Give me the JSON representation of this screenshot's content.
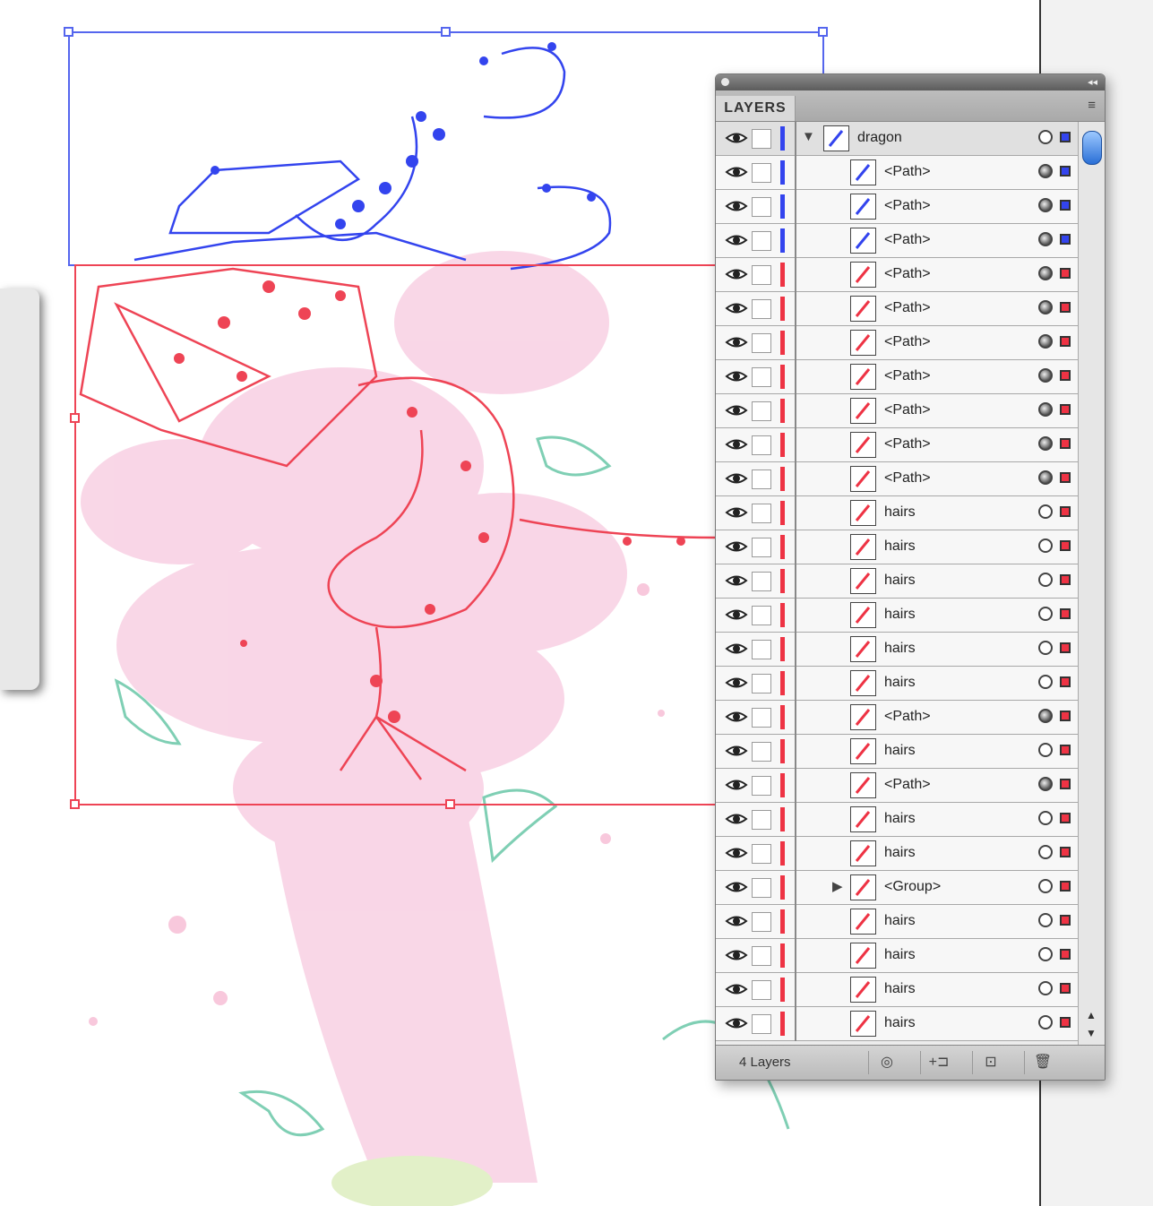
{
  "panel": {
    "tab_label": "LAYERS",
    "footer_count": "4 Layers",
    "colors": {
      "blue": "#3344ee",
      "red": "#ee3344",
      "pink": "#f5c4dc",
      "teal": "#9fd9c8"
    },
    "buttons": [
      {
        "name": "make-clipping-mask-button",
        "icon": "◎"
      },
      {
        "name": "create-sublayer-button",
        "icon": "+⊐"
      },
      {
        "name": "create-new-layer-button",
        "icon": "⊡"
      },
      {
        "name": "delete-layer-button",
        "icon": "🗑"
      }
    ],
    "menu_icon": "≡",
    "collapse_icon": "◂◂"
  },
  "layers": [
    {
      "name": "dragon",
      "type": "layer",
      "color": "#3344ee",
      "expanded": true,
      "target": "hollow"
    },
    {
      "name": "<Path>",
      "color": "#3344ee",
      "target": "filled"
    },
    {
      "name": "<Path>",
      "color": "#3344ee",
      "target": "filled"
    },
    {
      "name": "<Path>",
      "color": "#3344ee",
      "target": "filled"
    },
    {
      "name": "<Path>",
      "color": "#ee3344",
      "target": "filled"
    },
    {
      "name": "<Path>",
      "color": "#ee3344",
      "target": "filled"
    },
    {
      "name": "<Path>",
      "color": "#ee3344",
      "target": "filled"
    },
    {
      "name": "<Path>",
      "color": "#ee3344",
      "target": "filled"
    },
    {
      "name": "<Path>",
      "color": "#ee3344",
      "target": "filled"
    },
    {
      "name": "<Path>",
      "color": "#ee3344",
      "target": "filled"
    },
    {
      "name": "<Path>",
      "color": "#ee3344",
      "target": "filled"
    },
    {
      "name": "hairs",
      "color": "#ee3344",
      "target": "hollow"
    },
    {
      "name": "hairs",
      "color": "#ee3344",
      "target": "hollow"
    },
    {
      "name": "hairs",
      "color": "#ee3344",
      "target": "hollow"
    },
    {
      "name": "hairs",
      "color": "#ee3344",
      "target": "hollow"
    },
    {
      "name": "hairs",
      "color": "#ee3344",
      "target": "hollow"
    },
    {
      "name": "hairs",
      "color": "#ee3344",
      "target": "hollow"
    },
    {
      "name": "<Path>",
      "color": "#ee3344",
      "target": "filled"
    },
    {
      "name": "hairs",
      "color": "#ee3344",
      "target": "hollow"
    },
    {
      "name": "<Path>",
      "color": "#ee3344",
      "target": "filled"
    },
    {
      "name": "hairs",
      "color": "#ee3344",
      "target": "hollow"
    },
    {
      "name": "hairs",
      "color": "#ee3344",
      "target": "hollow"
    },
    {
      "name": "<Group>",
      "color": "#ee3344",
      "target": "hollow",
      "collapsed_group": true
    },
    {
      "name": "hairs",
      "color": "#ee3344",
      "target": "hollow"
    },
    {
      "name": "hairs",
      "color": "#ee3344",
      "target": "hollow"
    },
    {
      "name": "hairs",
      "color": "#ee3344",
      "target": "hollow"
    },
    {
      "name": "hairs",
      "color": "#ee3344",
      "target": "hollow"
    }
  ]
}
